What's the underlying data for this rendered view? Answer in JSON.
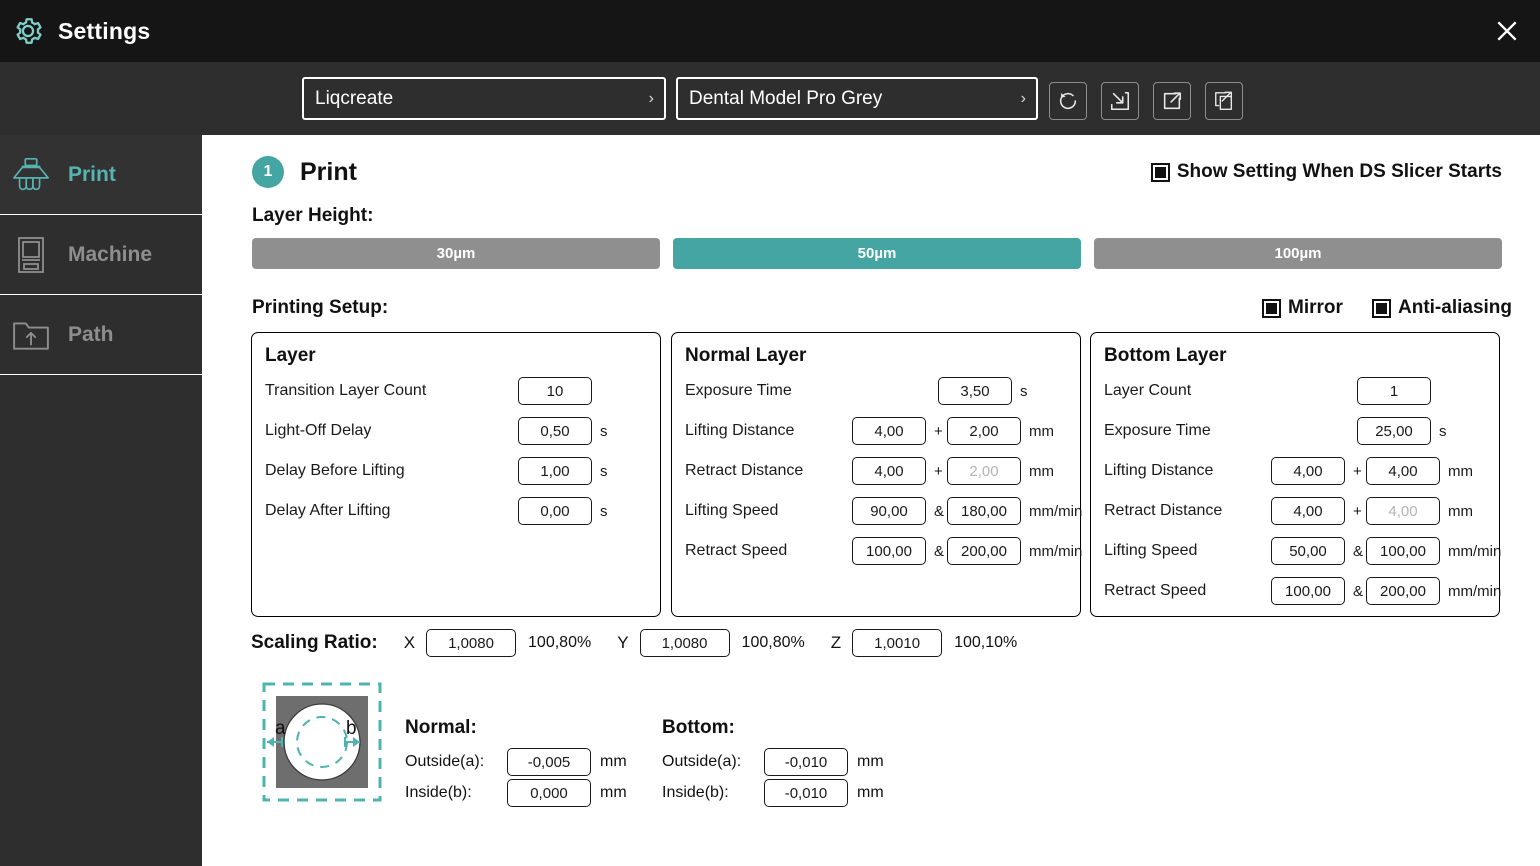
{
  "window": {
    "title": "Settings",
    "gear_icon": "gear-icon",
    "close_icon": "close-icon"
  },
  "toolbar": {
    "brand_select": {
      "value": "Liqcreate",
      "arrow": "›"
    },
    "resin_select": {
      "value": "Dental Model Pro Grey",
      "arrow": "›"
    },
    "buttons": [
      {
        "name": "reset-icon"
      },
      {
        "name": "import-icon"
      },
      {
        "name": "export-icon"
      },
      {
        "name": "save-as-icon"
      }
    ]
  },
  "sidebar": {
    "items": [
      {
        "label": "Print",
        "icon": "tooth-printer-icon",
        "active": true
      },
      {
        "label": "Machine",
        "icon": "machine-icon",
        "active": false
      },
      {
        "label": "Path",
        "icon": "folder-upload-icon",
        "active": false
      }
    ]
  },
  "main": {
    "step_number": "1",
    "section_title": "Print",
    "show_setting_checkbox": {
      "label": "Show Setting When DS Slicer Starts",
      "checked": true
    },
    "layer_height": {
      "label": "Layer Height:",
      "options": [
        "30µm",
        "50µm",
        "100µm"
      ],
      "selected": "50µm"
    },
    "printing_setup": {
      "label": "Printing Setup:",
      "mirror": {
        "label": "Mirror",
        "checked": true
      },
      "anti_aliasing": {
        "label": "Anti-aliasing",
        "checked": true
      }
    },
    "cards": {
      "layer": {
        "title": "Layer",
        "rows": [
          {
            "label": "Transition Layer Count",
            "value": "10",
            "unit": ""
          },
          {
            "label": "Light-Off Delay",
            "value": "0,50",
            "unit": "s"
          },
          {
            "label": "Delay Before Lifting",
            "value": "1,00",
            "unit": "s"
          },
          {
            "label": "Delay After Lifting",
            "value": "0,00",
            "unit": "s"
          }
        ]
      },
      "normal": {
        "title": "Normal Layer",
        "rows": [
          {
            "label": "Exposure Time",
            "value": "3,50",
            "unit": "s"
          },
          {
            "label": "Lifting Distance",
            "value_a": "4,00",
            "op": "+",
            "value_b": "2,00",
            "unit": "mm",
            "b_disabled": false
          },
          {
            "label": "Retract Distance",
            "value_a": "4,00",
            "op": "+",
            "value_b": "2,00",
            "unit": "mm",
            "b_disabled": true
          },
          {
            "label": "Lifting Speed",
            "value_a": "90,00",
            "op": "&",
            "value_b": "180,00",
            "unit": "mm/min",
            "b_disabled": false
          },
          {
            "label": "Retract Speed",
            "value_a": "100,00",
            "op": "&",
            "value_b": "200,00",
            "unit": "mm/min",
            "b_disabled": false
          }
        ]
      },
      "bottom": {
        "title": "Bottom Layer",
        "rows": [
          {
            "label": "Layer Count",
            "value": "1",
            "unit": ""
          },
          {
            "label": "Exposure Time",
            "value": "25,00",
            "unit": "s"
          },
          {
            "label": "Lifting Distance",
            "value_a": "4,00",
            "op": "+",
            "value_b": "4,00",
            "unit": "mm",
            "b_disabled": false
          },
          {
            "label": "Retract Distance",
            "value_a": "4,00",
            "op": "+",
            "value_b": "4,00",
            "unit": "mm",
            "b_disabled": true
          },
          {
            "label": "Lifting Speed",
            "value_a": "50,00",
            "op": "&",
            "value_b": "100,00",
            "unit": "mm/min",
            "b_disabled": false
          },
          {
            "label": "Retract Speed",
            "value_a": "100,00",
            "op": "&",
            "value_b": "200,00",
            "unit": "mm/min",
            "b_disabled": false
          }
        ]
      }
    },
    "scaling_ratio": {
      "label": "Scaling Ratio:",
      "x": {
        "axis": "X",
        "value": "1,0080",
        "percent": "100,80%"
      },
      "y": {
        "axis": "Y",
        "value": "1,0080",
        "percent": "100,80%"
      },
      "z": {
        "axis": "Z",
        "value": "1,0010",
        "percent": "100,10%"
      }
    },
    "compensation": {
      "figure_icon": "xy-compensation-icon",
      "figure_label_a": "a",
      "figure_label_b": "b",
      "normal": {
        "title": "Normal:",
        "outside_label": "Outside(a):",
        "outside_value": "-0,005",
        "outside_unit": "mm",
        "inside_label": "Inside(b):",
        "inside_value": "0,000",
        "inside_unit": "mm"
      },
      "bottom": {
        "title": "Bottom:",
        "outside_label": "Outside(a):",
        "outside_value": "-0,010",
        "outside_unit": "mm",
        "inside_label": "Inside(b):",
        "inside_value": "-0,010",
        "inside_unit": "mm"
      }
    }
  },
  "colors": {
    "accent": "#45a5a3",
    "titlebar_bg": "#151515",
    "chrome_bg": "#2e2e2e",
    "inactive_button": "#8f8f8f"
  }
}
